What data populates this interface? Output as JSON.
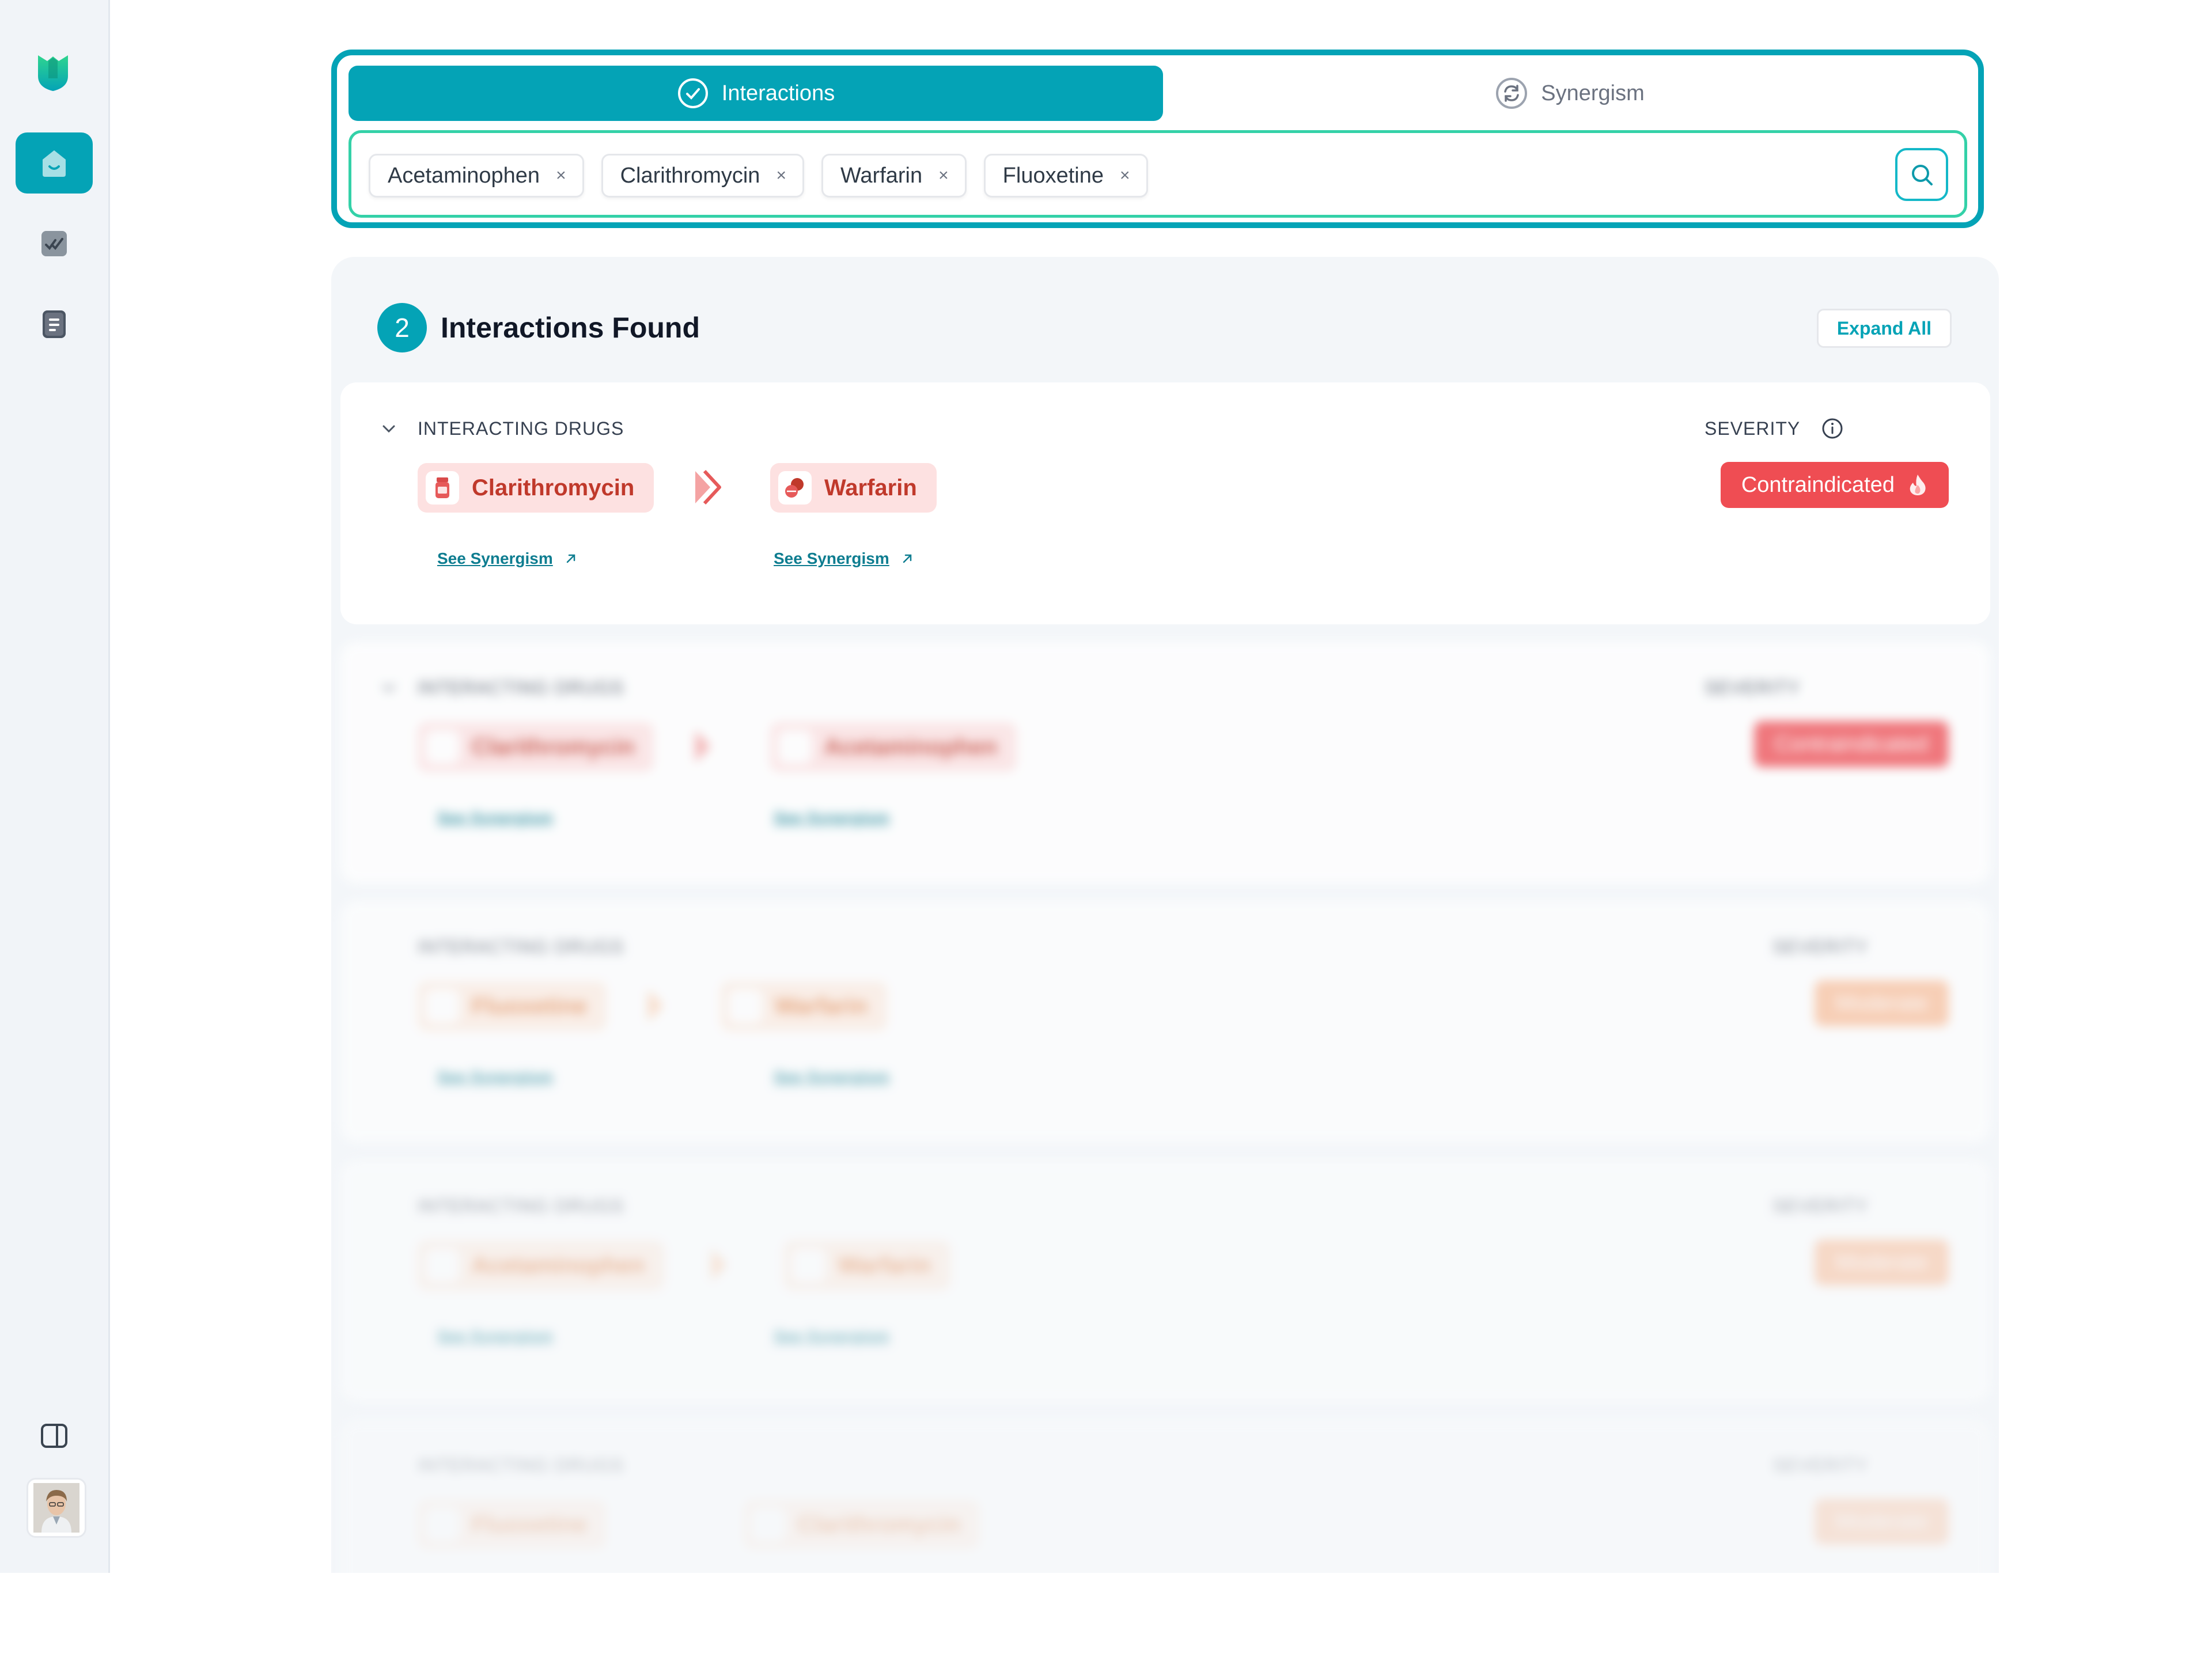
{
  "sidebar": {
    "nav": [
      "home-icon",
      "checklist-icon",
      "document-icon",
      "panel-toggle-icon"
    ],
    "accent": "#04a3b6"
  },
  "tabs": {
    "interactions": "Interactions",
    "synergism": "Synergism"
  },
  "search": {
    "chips": [
      "Acetaminophen",
      "Clarithromycin",
      "Warfarin",
      "Fluoxetine"
    ],
    "remove_glyph": "×"
  },
  "results": {
    "count": "2",
    "title": "Interactions Found",
    "expand_all": "Expand All",
    "cards": [
      {
        "label": "INTERACTING DRUGS",
        "severity_label": "SEVERITY",
        "drug_a": "Clarithromycin",
        "drug_b": "Warfarin",
        "severity": "Contraindicated",
        "link_a": "See Synergism",
        "link_b": "See Synergism"
      },
      {
        "label": "INTERACTING DRUGS",
        "severity_label": "SEVERITY",
        "drug_a": "Clarithromycin",
        "drug_b": "Acetaminophen",
        "severity": "Contraindicated",
        "link_a": "See Synergism",
        "link_b": "See Synergism"
      },
      {
        "label": "INTERACTING DRUGS",
        "severity_label": "SEVERITY",
        "drug_a": "Fluoxetine",
        "drug_b": "Warfarin",
        "severity": "Moderate",
        "link_a": "See Synergism",
        "link_b": "See Synergism"
      },
      {
        "label": "INTERACTING DRUGS",
        "severity_label": "SEVERITY",
        "drug_a": "Acetaminophen",
        "drug_b": "Warfarin",
        "severity": "Moderate",
        "link_a": "See Synergism",
        "link_b": "See Synergism"
      },
      {
        "label": "INTERACTING DRUGS",
        "severity_label": "SEVERITY",
        "drug_a": "Fluoxetine",
        "drug_b": "Clarithromycin",
        "severity": "Moderate",
        "link_a": "See Synergism",
        "link_b": "See Synergism"
      }
    ]
  },
  "colors": {
    "teal": "#04a3b6",
    "green_border": "#34d1a8",
    "contraindicated": "#ef4d53",
    "moderate": "#fbb58a"
  }
}
